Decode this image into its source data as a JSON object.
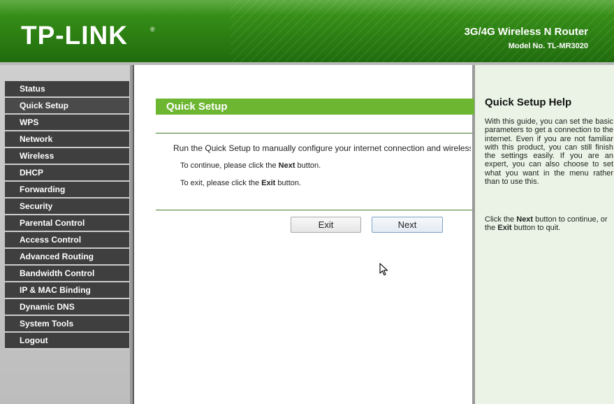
{
  "header": {
    "logo": "TP-LINK",
    "logo_mark": "®",
    "product_name": "3G/4G Wireless N Router",
    "model_no": "Model No. TL-MR3020"
  },
  "sidebar": {
    "items": [
      {
        "label": "Status"
      },
      {
        "label": "Quick Setup"
      },
      {
        "label": "WPS"
      },
      {
        "label": "Network"
      },
      {
        "label": "Wireless"
      },
      {
        "label": "DHCP"
      },
      {
        "label": "Forwarding"
      },
      {
        "label": "Security"
      },
      {
        "label": "Parental Control"
      },
      {
        "label": "Access Control"
      },
      {
        "label": "Advanced Routing"
      },
      {
        "label": "Bandwidth Control"
      },
      {
        "label": "IP & MAC Binding"
      },
      {
        "label": "Dynamic DNS"
      },
      {
        "label": "System Tools"
      },
      {
        "label": "Logout"
      }
    ]
  },
  "main": {
    "title": "Quick Setup",
    "intro": "Run the Quick Setup to manually configure your internet connection and wireless",
    "continue_pre": "To continue, please click the ",
    "continue_bold": "Next",
    "continue_post": " button.",
    "exit_pre": "To exit, please click the ",
    "exit_bold": "Exit",
    "exit_post": " button.",
    "exit_button": "Exit",
    "next_button": "Next"
  },
  "help": {
    "title": "Quick Setup Help",
    "paragraph1": "With this guide, you can set the basic parameters to get a connection to the internet. Even if you are not familiar with this product, you can still finish the settings easily. If you are an expert, you can also choose to set what you want in the menu rather than to use this.",
    "p2_pre": "Click the ",
    "p2_bold1": "Next",
    "p2_mid": " button to continue, or the ",
    "p2_bold2": "Exit",
    "p2_post": " button to quit."
  },
  "colors": {
    "header_green": "#2f8414",
    "title_bar_green": "#6cb631",
    "menu_dark": "#3f3f3f",
    "help_bg": "#eaf3e5"
  }
}
